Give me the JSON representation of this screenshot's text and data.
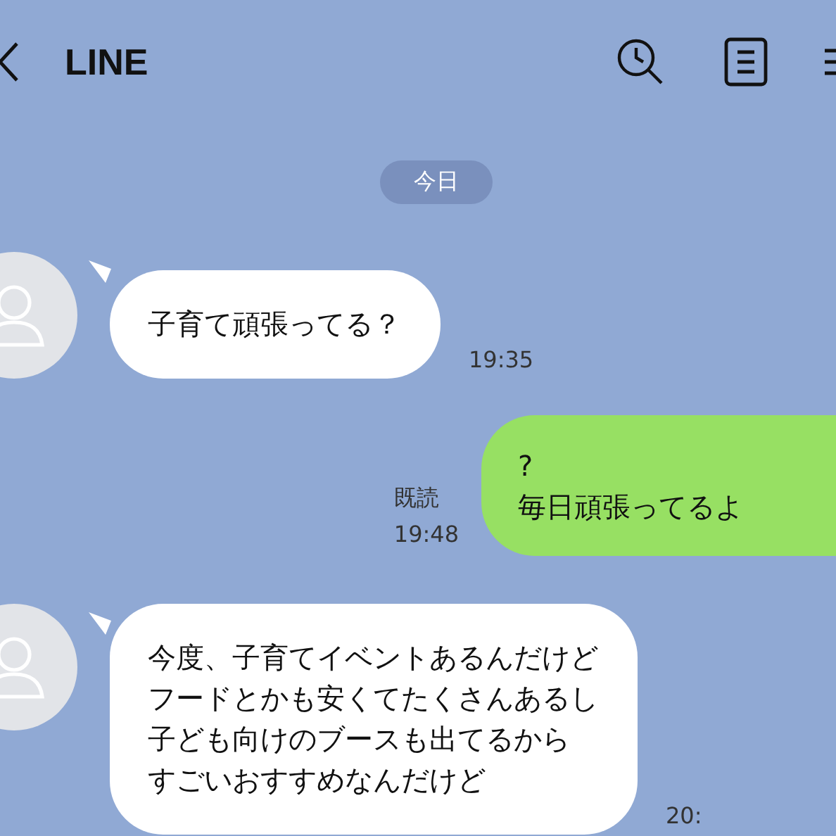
{
  "header": {
    "title": "LINE"
  },
  "date_divider": "今日",
  "messages": [
    {
      "kind": "incoming",
      "lines": [
        "子育て頑張ってる？"
      ],
      "time": "19:35"
    },
    {
      "kind": "outgoing",
      "lines": [
        "?",
        "毎日頑張ってるよ"
      ],
      "read_label": "既読",
      "time": "19:48"
    },
    {
      "kind": "incoming",
      "lines": [
        "今度、子育てイベントあるんだけど",
        "フードとかも安くてたくさんあるし",
        "子ども向けのブースも出てるから",
        "すごいおすすめなんだけど"
      ],
      "time": "20:"
    }
  ]
}
